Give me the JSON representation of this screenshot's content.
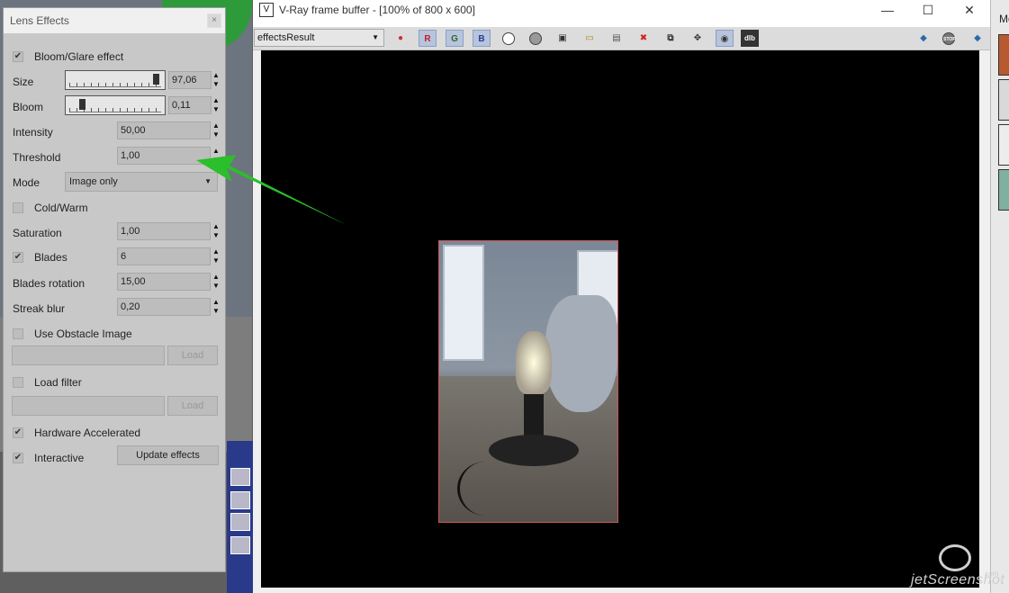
{
  "lens": {
    "title": "Lens Effects",
    "close_glyph": "×",
    "bloom_glare_label": "Bloom/Glare effect",
    "size_label": "Size",
    "size_value": "97,06",
    "size_fraction": 0.97,
    "bloom_label": "Bloom",
    "bloom_value": "0,11",
    "bloom_fraction": 0.11,
    "intensity_label": "Intensity",
    "intensity_value": "50,00",
    "threshold_label": "Threshold",
    "threshold_value": "1,00",
    "mode_label": "Mode",
    "mode_value": "Image only",
    "cold_warm_label": "Cold/Warm",
    "saturation_label": "Saturation",
    "saturation_value": "1,00",
    "blades_label": "Blades",
    "blades_value": "6",
    "blades_rotation_label": "Blades rotation",
    "blades_rotation_value": "15,00",
    "streak_blur_label": "Streak blur",
    "streak_blur_value": "0,20",
    "use_obstacle_label": "Use Obstacle Image",
    "obstacle_load_label": "Load",
    "load_filter_label": "Load filter",
    "filter_load_label": "Load",
    "hardware_accel_label": "Hardware Accelerated",
    "interactive_label": "Interactive",
    "update_effects_label": "Update effects",
    "checkbox_checked_glyph": "✔"
  },
  "vfb": {
    "title": "V-Ray frame buffer - [100% of 800 x 600]",
    "logo_glyph": "V",
    "minimize_glyph": "—",
    "maximize_glyph": "☐",
    "close_glyph": "✕",
    "channel_value": "effectsResult",
    "btn_r": "R",
    "btn_g": "G",
    "btn_b": "B",
    "btn_dlb": "dlb",
    "stop_label": "STOP"
  },
  "right_strip": {
    "label": "Mo"
  },
  "watermark": {
    "text": "jetScreenshot",
    "suffix": ".com"
  },
  "colors": {
    "arrow": "#2bbf2b",
    "panel_bg": "#c8c8c8",
    "canvas_bg": "#000000"
  }
}
